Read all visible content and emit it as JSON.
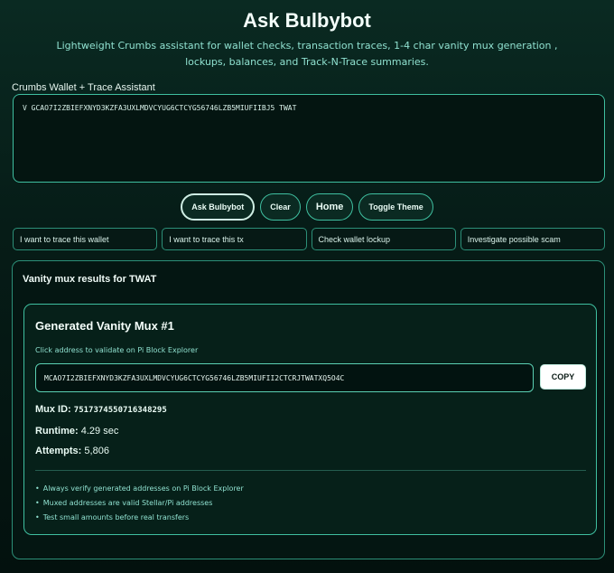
{
  "header": {
    "title": "Ask Bulbybot",
    "subtitle": "Lightweight Crumbs assistant for wallet checks, transaction traces, 1-4 char vanity mux generation , lockups, balances, and Track-N-Trace summaries."
  },
  "assistant": {
    "section_label": "Crumbs Wallet + Trace Assistant",
    "input_value": "V GCAO7I2ZBIEFXNYD3KZFA3UXLMDVCYUG6CTCYG56746LZB5MIUFIIBJ5 TWAT"
  },
  "buttons": {
    "ask": "Ask Bulbybot",
    "clear": "Clear",
    "home": "Home",
    "toggle_theme": "Toggle Theme"
  },
  "quick_actions": [
    "I want to trace this wallet",
    "I want to trace this tx",
    "Check wallet lockup",
    "Investigate possible scam"
  ],
  "results": {
    "heading": "Vanity mux results for TWAT",
    "card": {
      "title": "Generated Vanity Mux #1",
      "hint": "Click address to validate on Pi Block Explorer",
      "address": "MCAO7I2ZBIEFXNYD3KZFA3UXLMDVCYUG6CTCYG56746LZB5MIUFII2CTCRJTWATXQ5O4C",
      "copy_label": "COPY",
      "mux_id_label": "Mux ID:",
      "mux_id_value": "7517374550716348295",
      "runtime_label": "Runtime:",
      "runtime_value": "4.29 sec",
      "attempts_label": "Attempts:",
      "attempts_value": "5,806",
      "notes": [
        "Always verify generated addresses on Pi Block Explorer",
        "Muxed addresses are valid Stellar/Pi addresses",
        "Test small amounts before real transfers"
      ]
    }
  }
}
